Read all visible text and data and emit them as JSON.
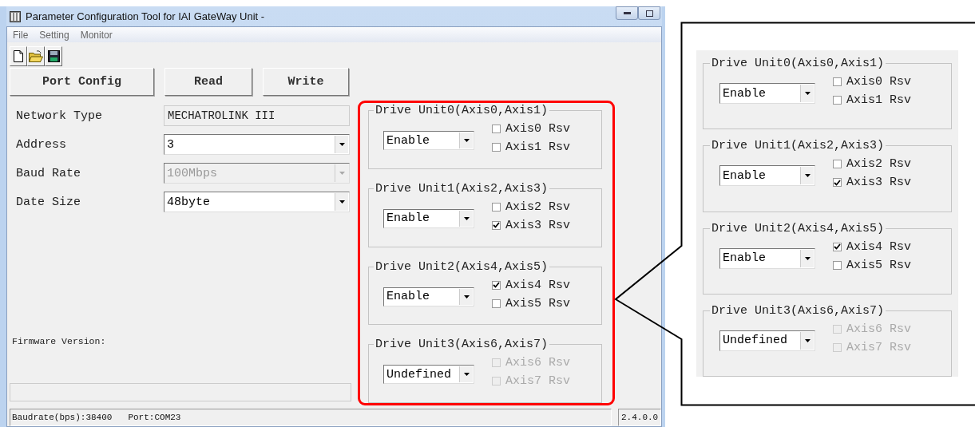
{
  "window": {
    "title": "Parameter Configuration Tool for IAI GateWay Unit -"
  },
  "menu": [
    "File",
    "Setting",
    "Monitor"
  ],
  "buttons": [
    "Port Config",
    "Read",
    "Write"
  ],
  "fields": [
    {
      "label": "Network Type",
      "value": "MECHATROLINK III",
      "kind": "readonly",
      "disabled": false
    },
    {
      "label": "Address",
      "value": "3",
      "kind": "dropdown",
      "disabled": false
    },
    {
      "label": "Baud Rate",
      "value": "100Mbps",
      "kind": "dropdown",
      "disabled": true
    },
    {
      "label": "Date Size",
      "value": "48byte",
      "kind": "dropdown",
      "disabled": false
    }
  ],
  "firmware_label": "Firmware Version:",
  "drive_units": [
    {
      "title": "Drive Unit0(Axis0,Axis1)",
      "mode": "Enable",
      "axes": [
        {
          "label": "Axis0 Rsv",
          "checked": false,
          "disabled": false
        },
        {
          "label": "Axis1 Rsv",
          "checked": false,
          "disabled": false
        }
      ]
    },
    {
      "title": "Drive Unit1(Axis2,Axis3)",
      "mode": "Enable",
      "axes": [
        {
          "label": "Axis2 Rsv",
          "checked": false,
          "disabled": false
        },
        {
          "label": "Axis3 Rsv",
          "checked": true,
          "disabled": false
        }
      ]
    },
    {
      "title": "Drive Unit2(Axis4,Axis5)",
      "mode": "Enable",
      "axes": [
        {
          "label": "Axis4 Rsv",
          "checked": true,
          "disabled": false
        },
        {
          "label": "Axis5 Rsv",
          "checked": false,
          "disabled": false
        }
      ]
    },
    {
      "title": "Drive Unit3(Axis6,Axis7)",
      "mode": "Undefined",
      "axes": [
        {
          "label": "Axis6 Rsv",
          "checked": false,
          "disabled": true
        },
        {
          "label": "Axis7 Rsv",
          "checked": false,
          "disabled": true
        }
      ]
    }
  ],
  "status_bar": {
    "baudrate": "Baudrate(bps):38400",
    "port": "Port:COM23",
    "version": "2.4.0.0"
  },
  "callout": {
    "drive_units": [
      {
        "title": "Drive Unit0(Axis0,Axis1)",
        "mode": "Enable",
        "axes": [
          {
            "label": "Axis0 Rsv",
            "checked": false,
            "disabled": false
          },
          {
            "label": "Axis1 Rsv",
            "checked": false,
            "disabled": false
          }
        ]
      },
      {
        "title": "Drive Unit1(Axis2,Axis3)",
        "mode": "Enable",
        "axes": [
          {
            "label": "Axis2 Rsv",
            "checked": false,
            "disabled": false
          },
          {
            "label": "Axis3 Rsv",
            "checked": true,
            "disabled": false
          }
        ]
      },
      {
        "title": "Drive Unit2(Axis4,Axis5)",
        "mode": "Enable",
        "axes": [
          {
            "label": "Axis4 Rsv",
            "checked": true,
            "disabled": false
          },
          {
            "label": "Axis5 Rsv",
            "checked": false,
            "disabled": false
          }
        ]
      },
      {
        "title": "Drive Unit3(Axis6,Axis7)",
        "mode": "Undefined",
        "axes": [
          {
            "label": "Axis6 Rsv",
            "checked": false,
            "disabled": true
          },
          {
            "label": "Axis7 Rsv",
            "checked": false,
            "disabled": true
          }
        ]
      }
    ]
  }
}
